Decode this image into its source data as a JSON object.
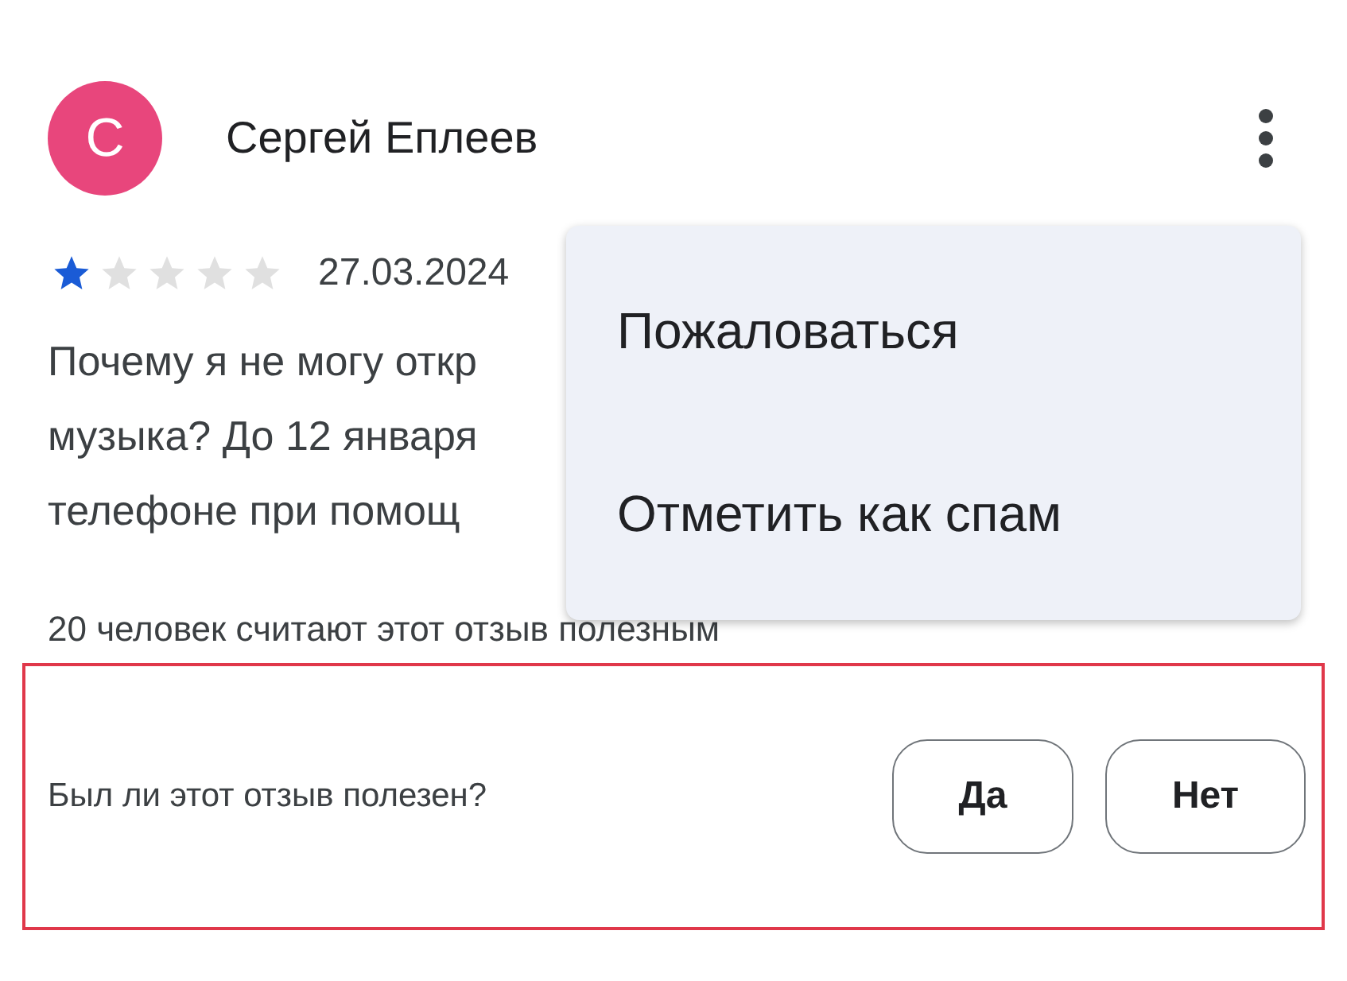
{
  "review": {
    "author": {
      "initial": "С",
      "name": "Сергей Еплеев"
    },
    "stars": 1,
    "date": "27.03.2024",
    "text_lines": [
      "Почему я не могу откр",
      "музыка? До 12 января",
      "телефоне при помощ"
    ],
    "helpful_count": "20 человек считают этот отзыв полезным"
  },
  "feedback": {
    "question": "Был ли этот отзыв полезен?",
    "buttons": [
      "Да",
      "Нет"
    ]
  },
  "menu": {
    "items": [
      "Пожаловаться",
      "Отметить как спам"
    ]
  }
}
